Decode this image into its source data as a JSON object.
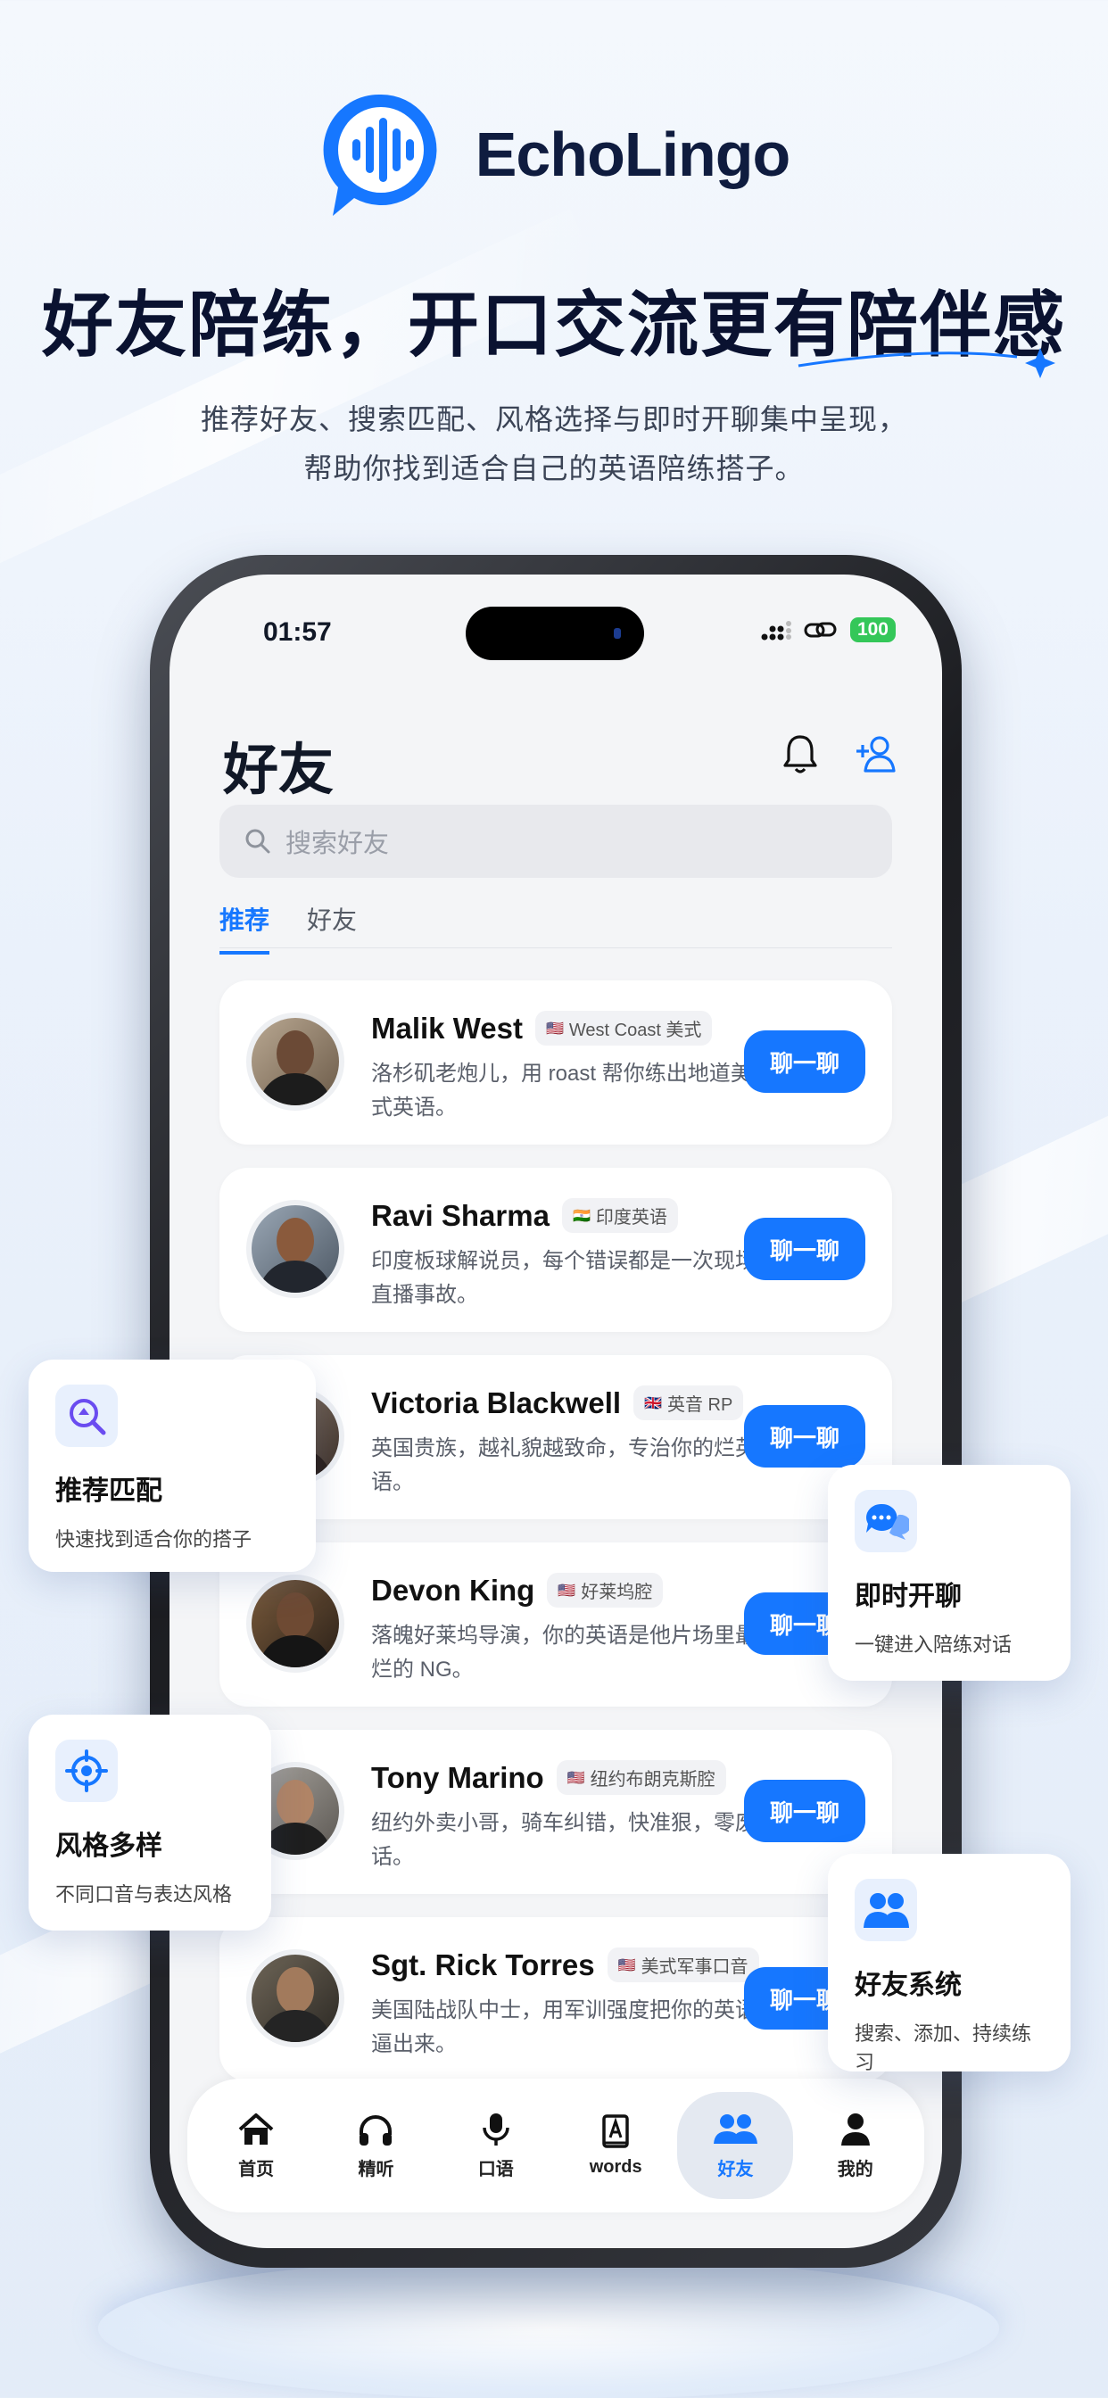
{
  "brand": {
    "name": "EchoLingo"
  },
  "hero": {
    "headline": "好友陪练，开口交流更有陪伴感",
    "subline_1": "推荐好友、搜索匹配、风格选择与即时开聊集中呈现，",
    "subline_2": "帮助你找到适合自己的英语陪练搭子。"
  },
  "statusbar": {
    "time": "01:57",
    "battery": "100"
  },
  "screen": {
    "title": "好友",
    "search_placeholder": "搜索好友",
    "tabs": [
      {
        "label": "推荐",
        "active": true
      },
      {
        "label": "好友",
        "active": false
      }
    ],
    "chat_label": "聊一聊",
    "friends": [
      {
        "name": "Malik West",
        "flag": "🇺🇸",
        "tag": "West Coast 美式",
        "desc": "洛杉矶老炮儿，用 roast 帮你练出地道美式英语。"
      },
      {
        "name": "Ravi Sharma",
        "flag": "🇮🇳",
        "tag": "印度英语",
        "desc": "印度板球解说员，每个错误都是一次现场直播事故。"
      },
      {
        "name": "Victoria Blackwell",
        "flag": "🇬🇧",
        "tag": "英音 RP",
        "desc": "英国贵族，越礼貌越致命，专治你的烂英语。"
      },
      {
        "name": "Devon King",
        "flag": "🇺🇸",
        "tag": "好莱坞腔",
        "desc": "落魄好莱坞导演，你的英语是他片场里最烂的 NG。"
      },
      {
        "name": "Tony Marino",
        "flag": "🇺🇸",
        "tag": "纽约布朗克斯腔",
        "desc": "纽约外卖小哥，骑车纠错，快准狠，零废话。"
      },
      {
        "name": "Sgt. Rick Torres",
        "flag": "🇺🇸",
        "tag": "美式军事口音",
        "desc": "美国陆战队中士，用军训强度把你的英语逼出来。"
      }
    ],
    "tabbar": [
      {
        "label": "首页",
        "icon": "home-icon",
        "active": false
      },
      {
        "label": "精听",
        "icon": "headphones-icon",
        "active": false
      },
      {
        "label": "口语",
        "icon": "microphone-icon",
        "active": false
      },
      {
        "label": "words",
        "icon": "book-icon",
        "active": false
      },
      {
        "label": "好友",
        "icon": "friends-icon",
        "active": true
      },
      {
        "label": "我的",
        "icon": "person-icon",
        "active": false
      }
    ]
  },
  "features": [
    {
      "title": "推荐匹配",
      "desc": "快速找到适合你的搭子",
      "icon": "search-match-icon"
    },
    {
      "title": "即时开聊",
      "desc": "一键进入陪练对话",
      "icon": "chat-bubbles-icon"
    },
    {
      "title": "风格多样",
      "desc": "不同口音与表达风格",
      "icon": "target-icon"
    },
    {
      "title": "好友系统",
      "desc": "搜索、添加、持续练习",
      "icon": "people-icon"
    }
  ],
  "colors": {
    "accent": "#1677ff",
    "title": "#0a1230"
  }
}
